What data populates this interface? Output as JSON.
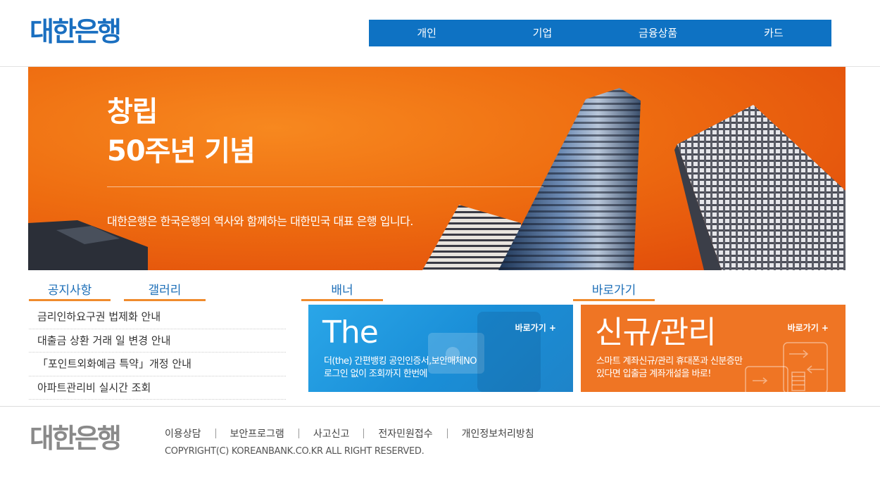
{
  "header": {
    "logo": "대한은행",
    "nav": [
      "개인",
      "기업",
      "금융상품",
      "카드"
    ]
  },
  "hero": {
    "title_line1": "창립",
    "title_line2": "50주년 기념",
    "subtitle": "대한은행은 한국은행의 역사와 함께하는 대한민국 대표 은행 입니다."
  },
  "sections": {
    "notice_tab": "공지사항",
    "gallery_tab": "갤러리",
    "banner_tab": "배너",
    "shortcut_tab": "바로가기"
  },
  "notices": [
    "금리인하요구권 법제화 안내",
    "대출금 상환 거래 일 변경 안내",
    "「포인트외화예금 특약」개정 안내",
    "아파트관리비 실시간 조회"
  ],
  "banner_blue": {
    "big": "The",
    "go": "바로가기 +",
    "desc_line1": "더(the) 간편뱅킹 공인인증서,보안매체NO",
    "desc_line2": "로그인 없이 조회까지 한번에"
  },
  "banner_orange": {
    "big": "신규/관리",
    "go": "바로가기 +",
    "desc_line1": "스마트 계좌신규/관리 휴대폰과 신분증만",
    "desc_line2": "있다면 입출금 계좌개설을 바로!"
  },
  "footer": {
    "logo": "대한은행",
    "links": [
      "이용상담",
      "보안프로그램",
      "사고신고",
      "전자민원접수",
      "개인정보처리방침"
    ],
    "copyright": "COPYRIGHT(C) KOREANBANK.CO.KR ALL RIGHT RESERVED."
  },
  "colors": {
    "brand_blue": "#1a6fc0",
    "nav_blue": "#0e72c3",
    "accent_orange": "#f08b2d",
    "hero_orange": "#ee6c10"
  }
}
